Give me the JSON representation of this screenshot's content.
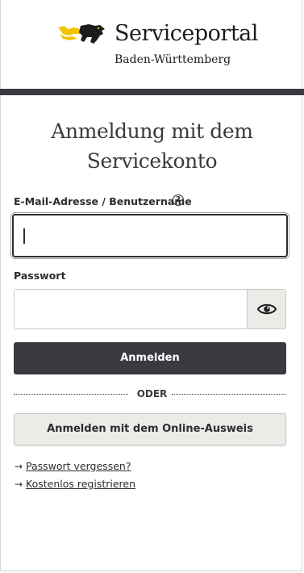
{
  "header": {
    "logo_icon": "baden-wuerttemberg-lions-logo",
    "title": "Serviceportal",
    "subtitle": "Baden-Württemberg",
    "accent_color": "#3a3b40",
    "logo_color": "#f2c300"
  },
  "form": {
    "heading": "Anmeldung mit dem Servicekonto",
    "email_label": "E-Mail-Adresse / Benutzername",
    "help_icon": "?",
    "email_value": "",
    "password_label": "Passwort",
    "password_value": "",
    "show_password_icon": "eye-icon",
    "submit_label": "Anmelden",
    "separator": "ODER",
    "online_id_label": "Anmelden mit dem Online-Ausweis"
  },
  "links": [
    {
      "icon": "→",
      "label": "Passwort vergessen?"
    },
    {
      "icon": "→",
      "label": "Kostenlos registrieren"
    }
  ]
}
